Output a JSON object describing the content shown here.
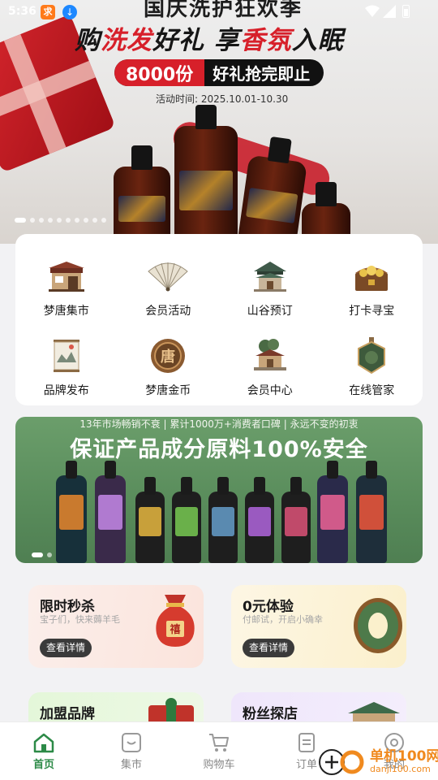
{
  "status_bar": {
    "time": "5:36",
    "app1_glyph": "求"
  },
  "hero": {
    "top_line": "国庆洗护狂欢季",
    "title_parts": [
      "购",
      "洗发",
      "好礼 享",
      "香氛",
      "入眠"
    ],
    "pill_count": "8000份",
    "pill_message": "好礼抢完即止",
    "date_label": "活动时间: 2025.10.01-10.30",
    "bottle_brand": "IFLOW",
    "slide_count": 10,
    "active_slide": 0
  },
  "menu": {
    "items": [
      {
        "label": "梦唐集市",
        "icon": "market-stall-icon"
      },
      {
        "label": "会员活动",
        "icon": "folding-fan-icon"
      },
      {
        "label": "山谷预订",
        "icon": "pavilion-icon"
      },
      {
        "label": "打卡寻宝",
        "icon": "treasure-chest-icon"
      },
      {
        "label": "品牌发布",
        "icon": "scroll-painting-icon"
      },
      {
        "label": "梦唐金币",
        "icon": "gold-coin-icon"
      },
      {
        "label": "会员中心",
        "icon": "pavilion-tree-icon"
      },
      {
        "label": "在线管家",
        "icon": "jade-pendant-icon"
      }
    ],
    "coin_glyph": "唐"
  },
  "promo": {
    "subtitle": "13年市场畅销不衰 | 累计1000万+消费者口碑 | 永远不变的初衷",
    "title": "保证产品成分原料100%安全",
    "bottle_labels": [
      "迎客",
      "宝钗",
      "紫金百花",
      "森山绿荫",
      "湖蝶恋花",
      "知梦松雪",
      "星辰漂流",
      "可颂",
      "寻宝"
    ],
    "slide_count": 2,
    "active_slide": 0
  },
  "features": [
    {
      "title": "限时秒杀",
      "subtitle": "宝子们，快来薅羊毛",
      "button": "查看详情",
      "icon": "lucky-bag-icon",
      "bag_glyph": "禧"
    },
    {
      "title": "0元体验",
      "subtitle": "付邮试，开启小确幸",
      "button": "查看详情",
      "icon": "jade-ring-icon"
    },
    {
      "title": "加盟品牌",
      "icon": "gift-box-icon"
    },
    {
      "title": "粉丝探店",
      "icon": "storefront-icon"
    }
  ],
  "bottom_nav": {
    "items": [
      {
        "label": "首页",
        "icon": "home-icon",
        "active": true
      },
      {
        "label": "集市",
        "icon": "market-icon",
        "active": false
      },
      {
        "label": "购物车",
        "icon": "cart-icon",
        "active": false
      },
      {
        "label": "订单",
        "icon": "order-icon",
        "active": false
      },
      {
        "label": "我的",
        "icon": "profile-icon",
        "active": false
      }
    ]
  },
  "watermark": {
    "name": "单机100网",
    "url": "danji100.com"
  },
  "colors": {
    "accent_red": "#d7202a",
    "nav_active": "#2c8a47",
    "promo_green": "#5a8d5c"
  }
}
